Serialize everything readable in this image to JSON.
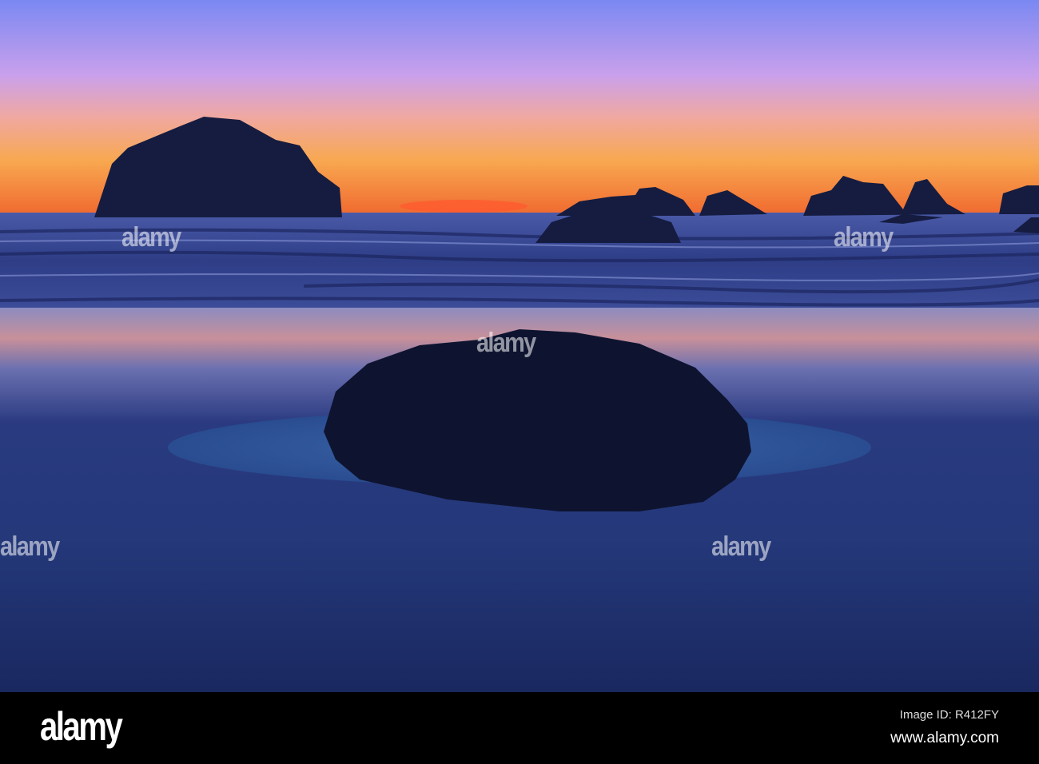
{
  "watermark": {
    "text": "alamy"
  },
  "footer": {
    "logo": "alamy",
    "image_id": "Image ID: R412FY",
    "site": "www.alamy.com"
  }
}
